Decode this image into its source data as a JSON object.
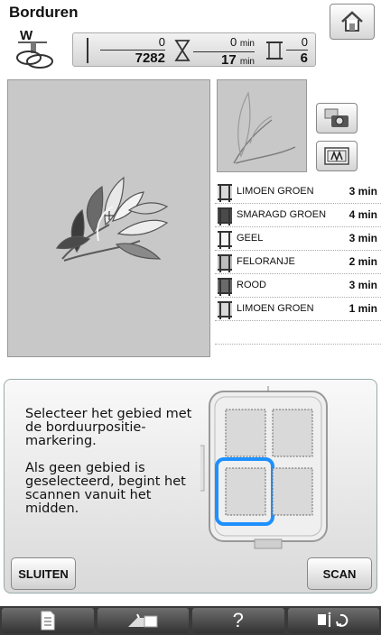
{
  "header": {
    "title": "Borduren"
  },
  "presser_foot": {
    "label": "W",
    "icon": "presser-foot-icon"
  },
  "counters": {
    "stitches_done": "0",
    "stitches_total": "7282",
    "time_done": "0",
    "time_total": "17",
    "time_unit": "min",
    "colors_done": "0",
    "colors_total": "6"
  },
  "threads": [
    {
      "name": "LIMOEN GROEN",
      "time": "3 min",
      "color": "#d9d9d9"
    },
    {
      "name": "SMARAGD GROEN",
      "time": "4 min",
      "color": "#4a4a4a"
    },
    {
      "name": "GEEL",
      "time": "3 min",
      "color": "#f5f5f5"
    },
    {
      "name": "FELORANJE",
      "time": "2 min",
      "color": "#bdbdbd"
    },
    {
      "name": "ROOD",
      "time": "3 min",
      "color": "#6a6a6a"
    },
    {
      "name": "LIMOEN GROEN",
      "time": "1 min",
      "color": "#d9d9d9"
    }
  ],
  "info": {
    "paragraph1": "Selecteer het gebied met de borduurpositie-markering.",
    "paragraph2": "Als geen gebied is geselecteerd, begint het scannen vanuit het midden."
  },
  "buttons": {
    "close": "SLUITEN",
    "scan": "SCAN"
  },
  "bottom_bar": {
    "items": [
      "document-icon",
      "embroidery-unit-icon",
      "?",
      "settings-icon"
    ],
    "help": "?"
  },
  "colors": {
    "selection": "#1e90ff",
    "preview_bg": "#c8c8c8",
    "bottom_bar": "#3a3a3a"
  }
}
